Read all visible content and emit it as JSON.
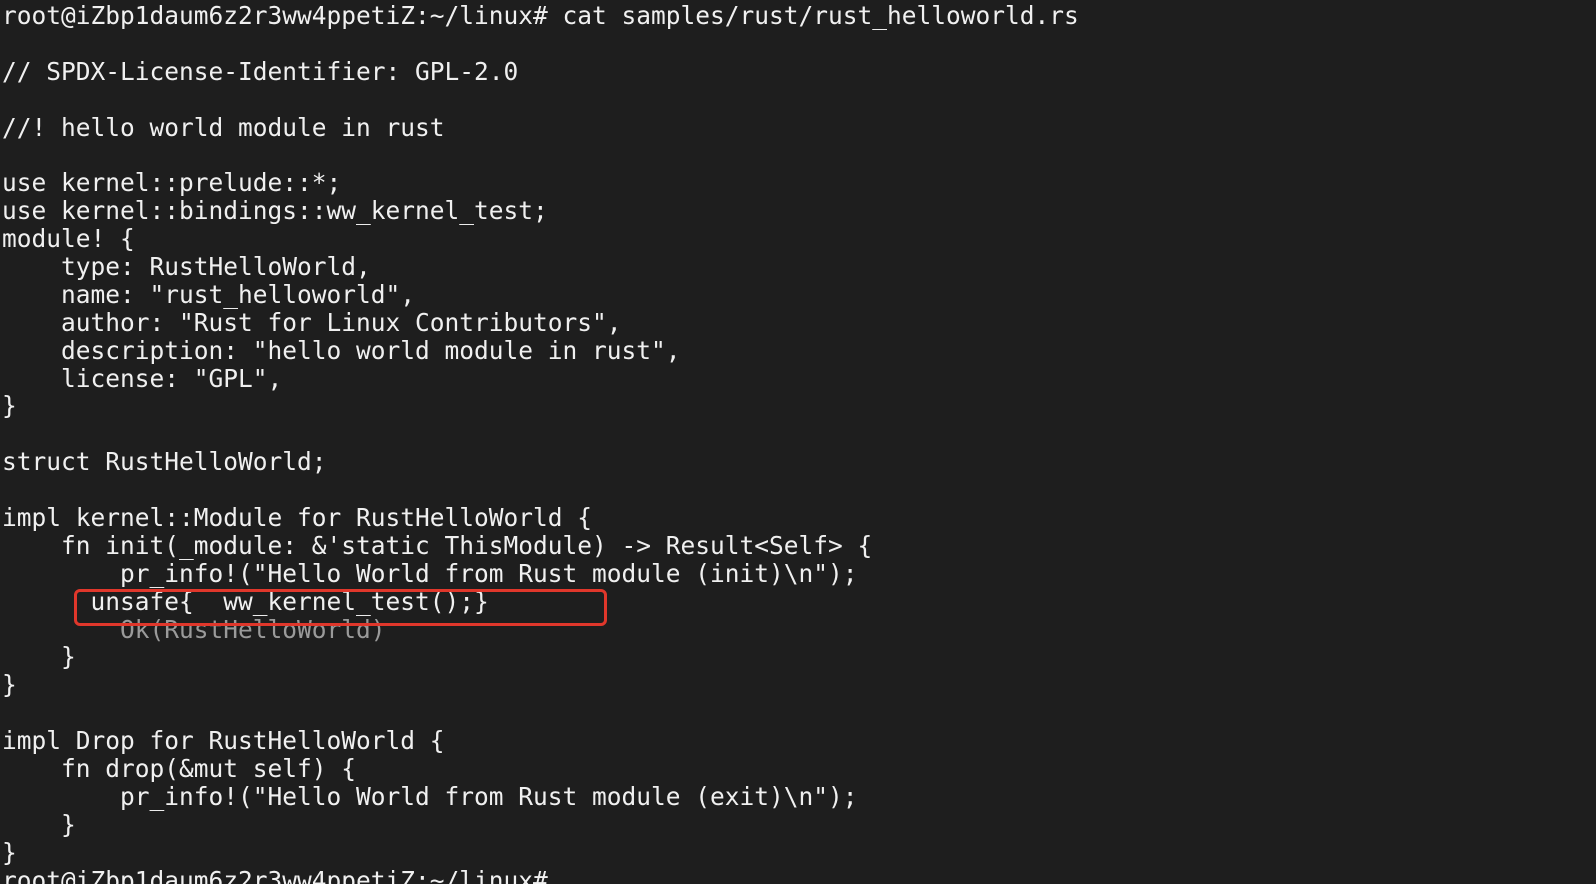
{
  "terminal": {
    "prompt_command": "root@iZbp1daum6z2r3ww4ppetiZ:~/linux# cat samples/rust/rust_helloworld.rs",
    "lines": [
      "",
      "// SPDX-License-Identifier: GPL-2.0",
      "",
      "//! hello world module in rust",
      "",
      "use kernel::prelude::*;",
      "use kernel::bindings::ww_kernel_test;",
      "module! {",
      "    type: RustHelloWorld,",
      "    name: \"rust_helloworld\",",
      "    author: \"Rust for Linux Contributors\",",
      "    description: \"hello world module in rust\",",
      "    license: \"GPL\",",
      "}",
      "",
      "struct RustHelloWorld;",
      "",
      "impl kernel::Module for RustHelloWorld {",
      "    fn init(_module: &'static ThisModule) -> Result<Self> {",
      "        pr_info!(\"Hello World from Rust module (init)\\n\");",
      "      unsafe{  ww_kernel_test();}",
      "        Ok(RustHelloWorld)",
      "    }",
      "}",
      "",
      "impl Drop for RustHelloWorld {",
      "    fn drop(&mut self) {",
      "        pr_info!(\"Hello World from Rust module (exit)\\n\");",
      "    }",
      "}"
    ],
    "final_prompt": "root@iZbp1daum6z2r3ww4ppetiZ:~/linux#"
  },
  "annotation": {
    "color": "#e0372b",
    "highlighted_text": "unsafe{  ww_kernel_test();}"
  },
  "colors": {
    "background": "#1e1e1e",
    "foreground": "#f0f0f0"
  }
}
